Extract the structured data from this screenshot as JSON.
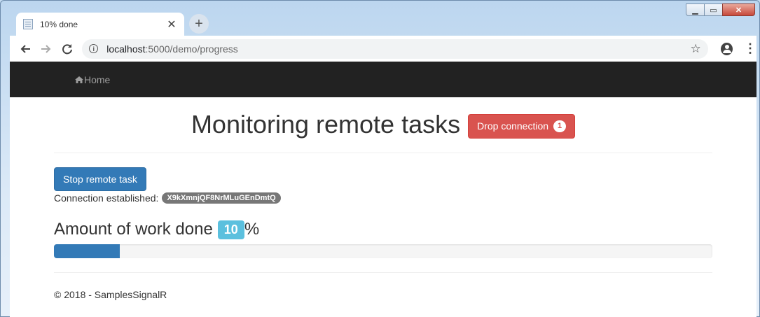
{
  "browser": {
    "tab_title": "10% done",
    "tab_close": "✕",
    "new_tab": "+",
    "url_host": "localhost",
    "url_path": ":5000/demo/progress",
    "window_min": "▁",
    "window_max": "▭",
    "window_close": "✕"
  },
  "navbar": {
    "home_label": "Home"
  },
  "main": {
    "title": "Monitoring remote tasks",
    "drop_button_label": "Drop connection",
    "drop_badge": "1",
    "stop_button_label": "Stop remote task",
    "connection_label": "Connection established:",
    "connection_id": "X9kXmnjQF8NrMLuGEnDmtQ",
    "work_label": "Amount of work done",
    "work_value": "10",
    "work_unit": "%",
    "progress_fraction": 0.1
  },
  "footer": {
    "text": "© 2018 - SamplesSignalR"
  },
  "colors": {
    "navbar_bg": "#222222",
    "danger": "#d9534f",
    "primary": "#337ab7",
    "info": "#5bc0de",
    "badge_grey": "#777777"
  }
}
